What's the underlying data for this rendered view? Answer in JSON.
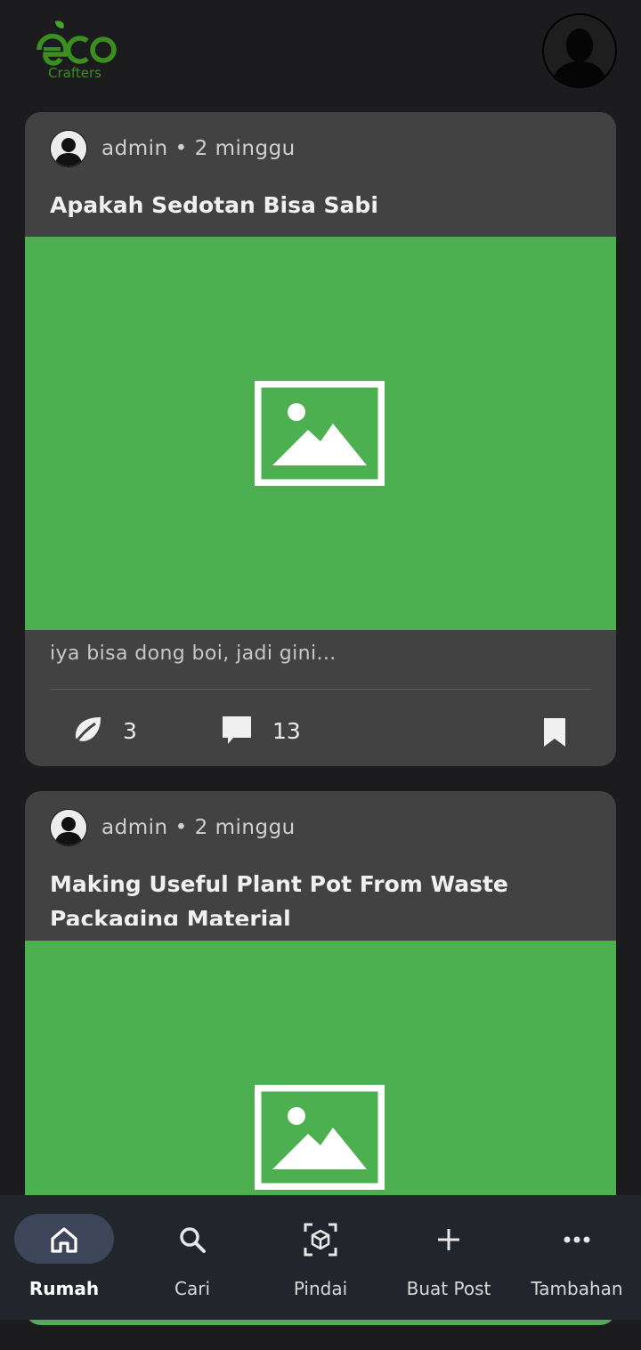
{
  "app": {
    "logo_text": "eco",
    "logo_sub": "Crafters",
    "colors": {
      "accent_green": "#4caf50",
      "logo_green": "#3a8f1f",
      "card_bg": "#424242",
      "nav_bg": "#23252d",
      "nav_active": "#3d4658"
    }
  },
  "posts": [
    {
      "author": "admin",
      "separator": "•",
      "time": "2 minggu",
      "title": "Apakah Sedotan Bisa Sabi",
      "excerpt": "iya bisa dong boi, jadi gini...",
      "likes": "3",
      "comments": "13"
    },
    {
      "author": "admin",
      "separator": "•",
      "time": "2 minggu",
      "title": "Making Useful Plant Pot From Waste Packaging Material"
    }
  ],
  "nav": [
    {
      "label": "Rumah",
      "icon": "home-icon",
      "active": true
    },
    {
      "label": "Cari",
      "icon": "search-icon"
    },
    {
      "label": "Pindai",
      "icon": "scan-icon"
    },
    {
      "label": "Buat Post",
      "icon": "plus-icon"
    },
    {
      "label": "Tambahan",
      "icon": "more-icon"
    }
  ]
}
